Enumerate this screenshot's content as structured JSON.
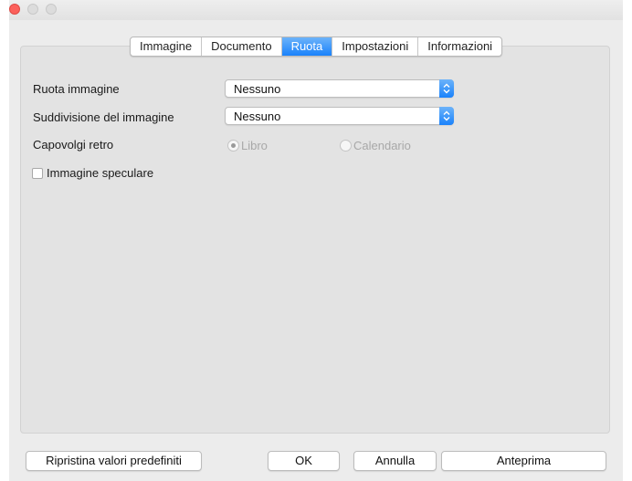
{
  "tabs": [
    {
      "label": "Immagine",
      "active": false
    },
    {
      "label": "Documento",
      "active": false
    },
    {
      "label": "Ruota",
      "active": true
    },
    {
      "label": "Impostazioni",
      "active": false
    },
    {
      "label": "Informazioni",
      "active": false
    }
  ],
  "form": {
    "rotate_label": "Ruota immagine",
    "rotate_value": "Nessuno",
    "split_label": "Suddivisione del immagine",
    "split_value": "Nessuno",
    "flip_label": "Capovolgi retro",
    "flip_options": [
      {
        "label": "Libro",
        "selected": true,
        "disabled": true
      },
      {
        "label": "Calendario",
        "selected": false,
        "disabled": true
      }
    ],
    "mirror_label": "Immagine speculare",
    "mirror_checked": false
  },
  "buttons": {
    "reset": "Ripristina valori predefiniti",
    "ok": "OK",
    "cancel": "Annulla",
    "preview": "Anteprima"
  },
  "colors": {
    "accent": "#1a82fb",
    "close": "#fc605b",
    "panel": "#e3e3e3"
  },
  "icons": {
    "window_close": "close-dot",
    "popup_arrows": "updown-chevrons"
  }
}
